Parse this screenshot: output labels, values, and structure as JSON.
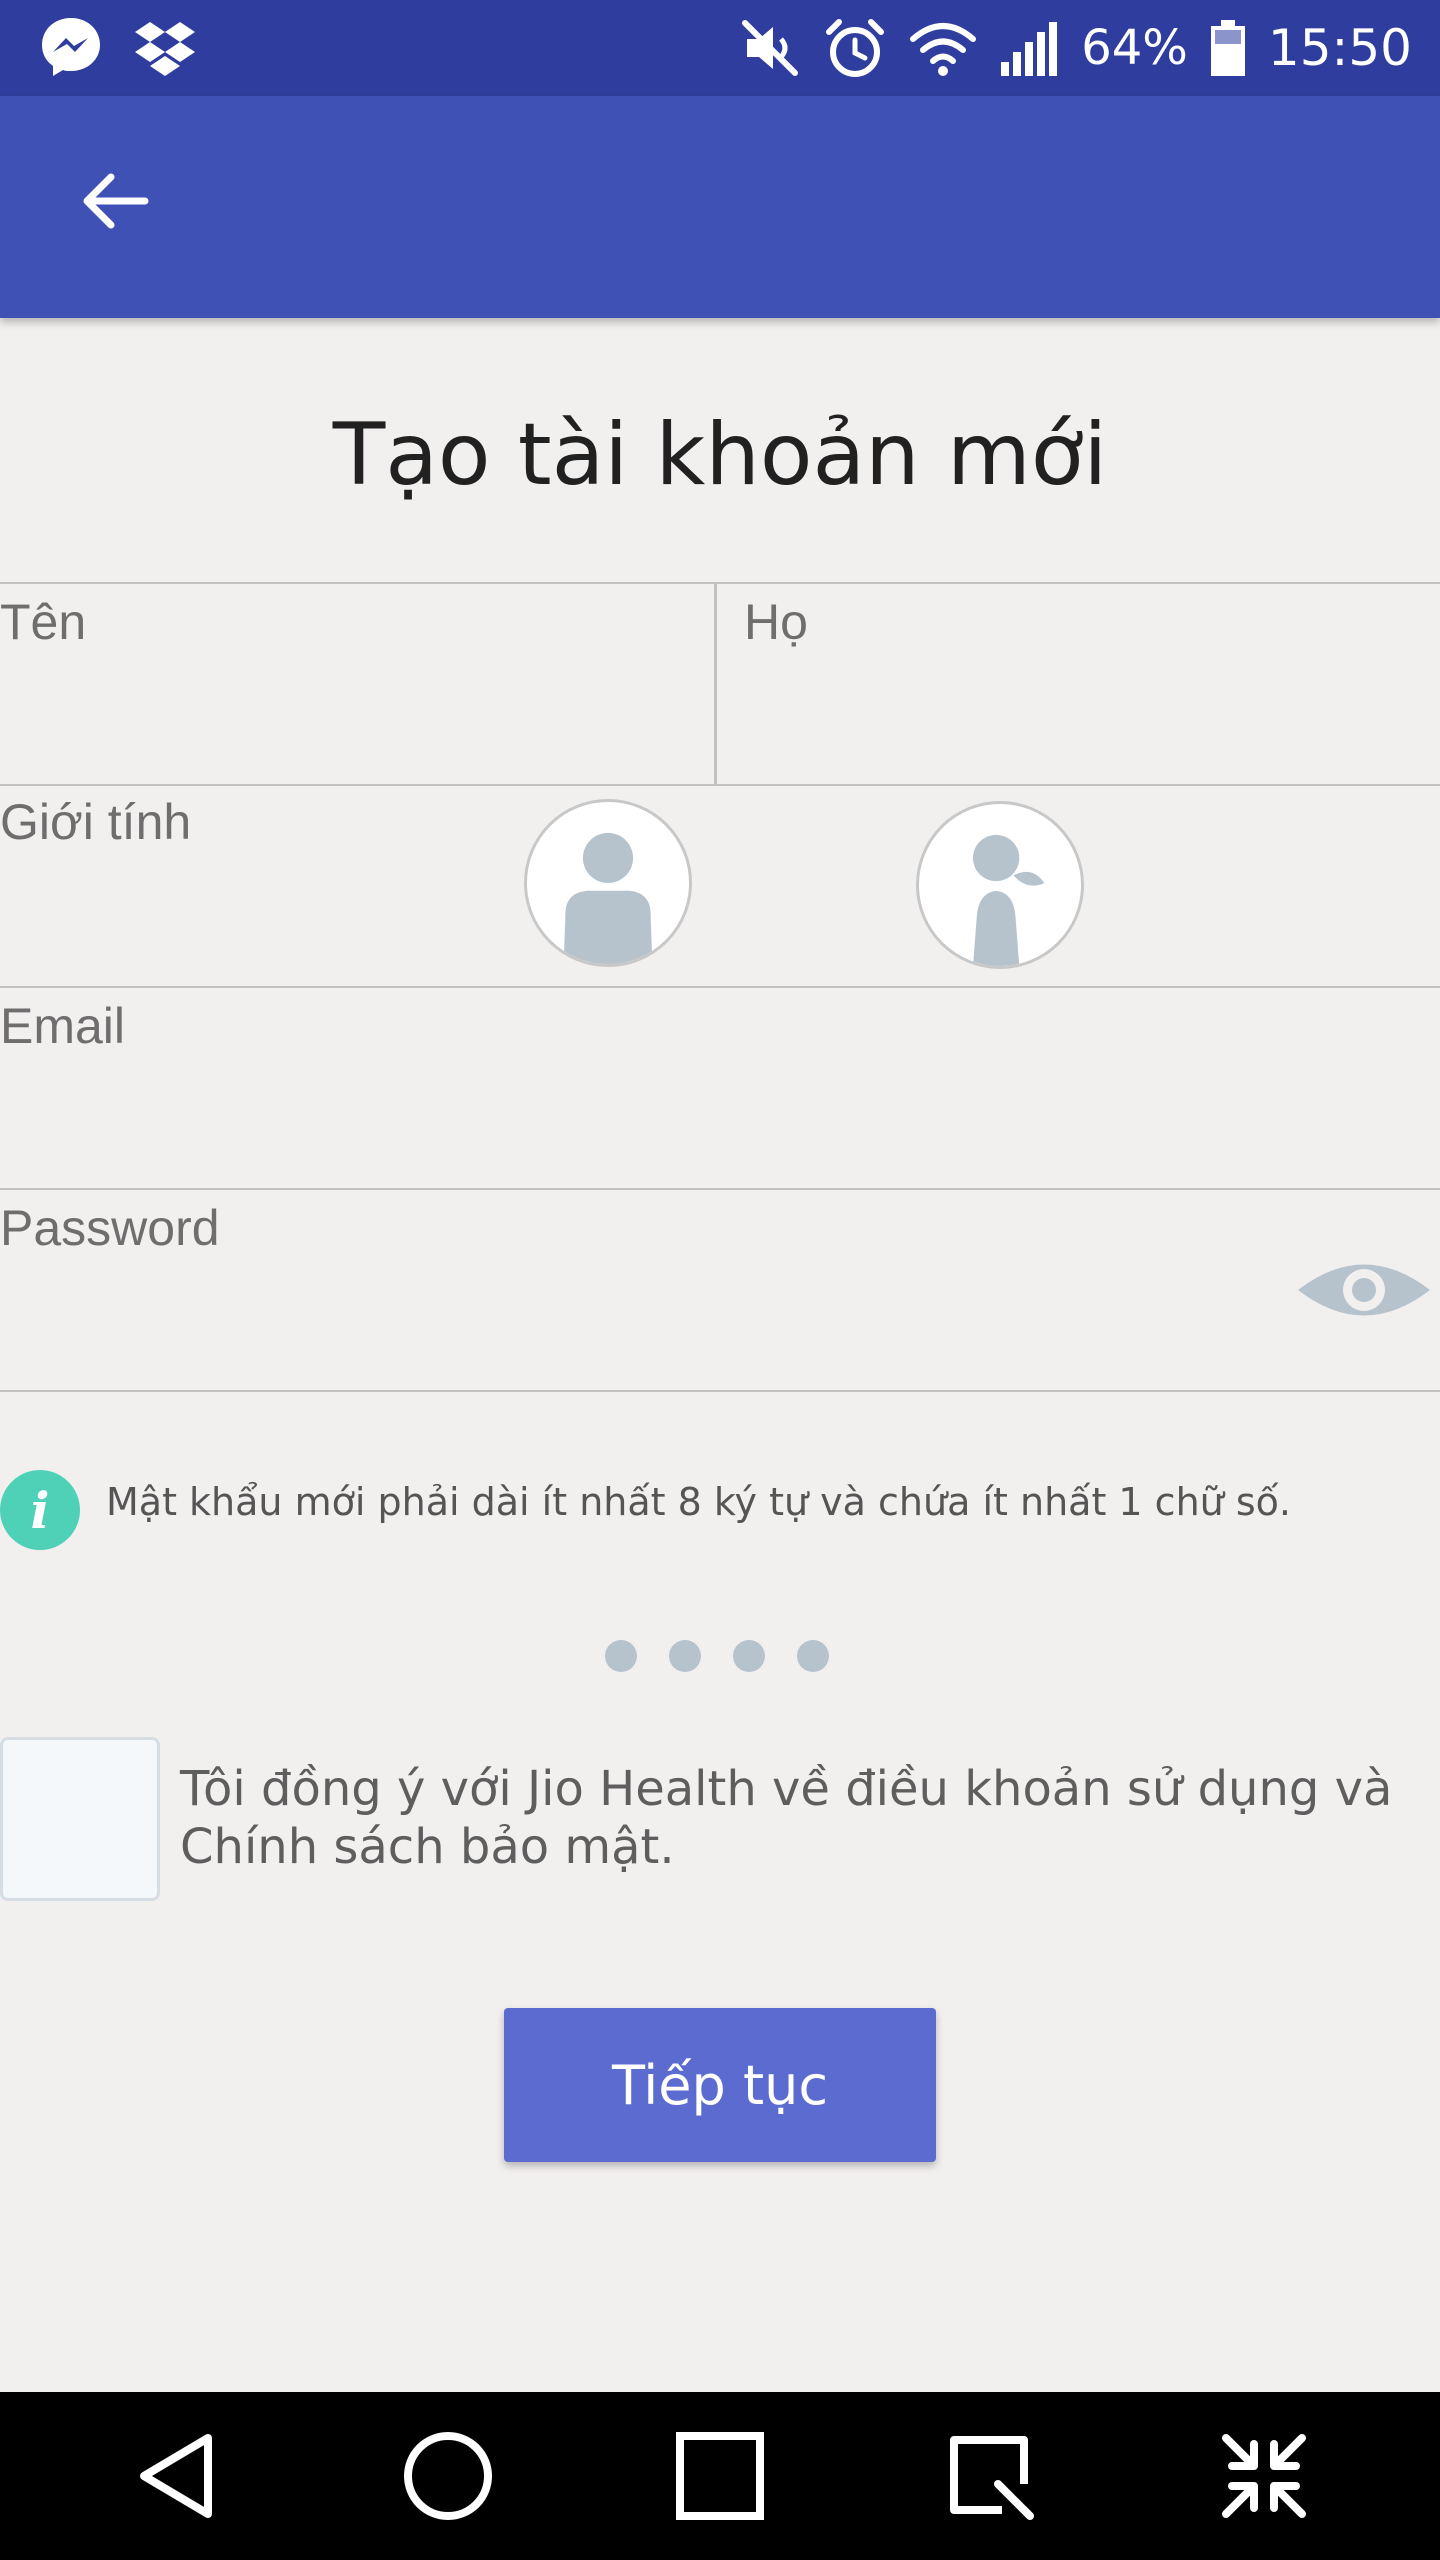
{
  "status_bar": {
    "battery": "64%",
    "time": "15:50",
    "icons": [
      "messenger-icon",
      "dropbox-icon",
      "mute-icon",
      "alarm-icon",
      "wifi-icon",
      "signal-icon",
      "battery-icon"
    ]
  },
  "toolbar": {
    "back_icon": "arrow-left-icon"
  },
  "page": {
    "title": "Tạo tài khoản mới"
  },
  "form": {
    "first_name_label": "Tên",
    "last_name_label": "Họ",
    "gender_label": "Giới tính",
    "email_label": "Email",
    "password_label": "Password",
    "gender_options": [
      "male-avatar-icon",
      "female-avatar-icon"
    ],
    "password_toggle_icon": "eye-icon"
  },
  "hint": {
    "icon": "info-icon",
    "glyph": "i",
    "text": "Mật khẩu mới phải dài ít nhất 8 ký tự và chứa  ít nhất 1 chữ số."
  },
  "pager": {
    "count": 4
  },
  "terms": {
    "text": "Tôi đồng ý với Jio Health về điều khoản sử dụng và Chính sách bảo mật.",
    "checked": false
  },
  "actions": {
    "continue_label": "Tiếp tục"
  },
  "colors": {
    "status_bar": "#2f3e9e",
    "toolbar": "#3f51b5",
    "button": "#5c6bcf",
    "info": "#4fd1b8",
    "background": "#f2efef"
  }
}
